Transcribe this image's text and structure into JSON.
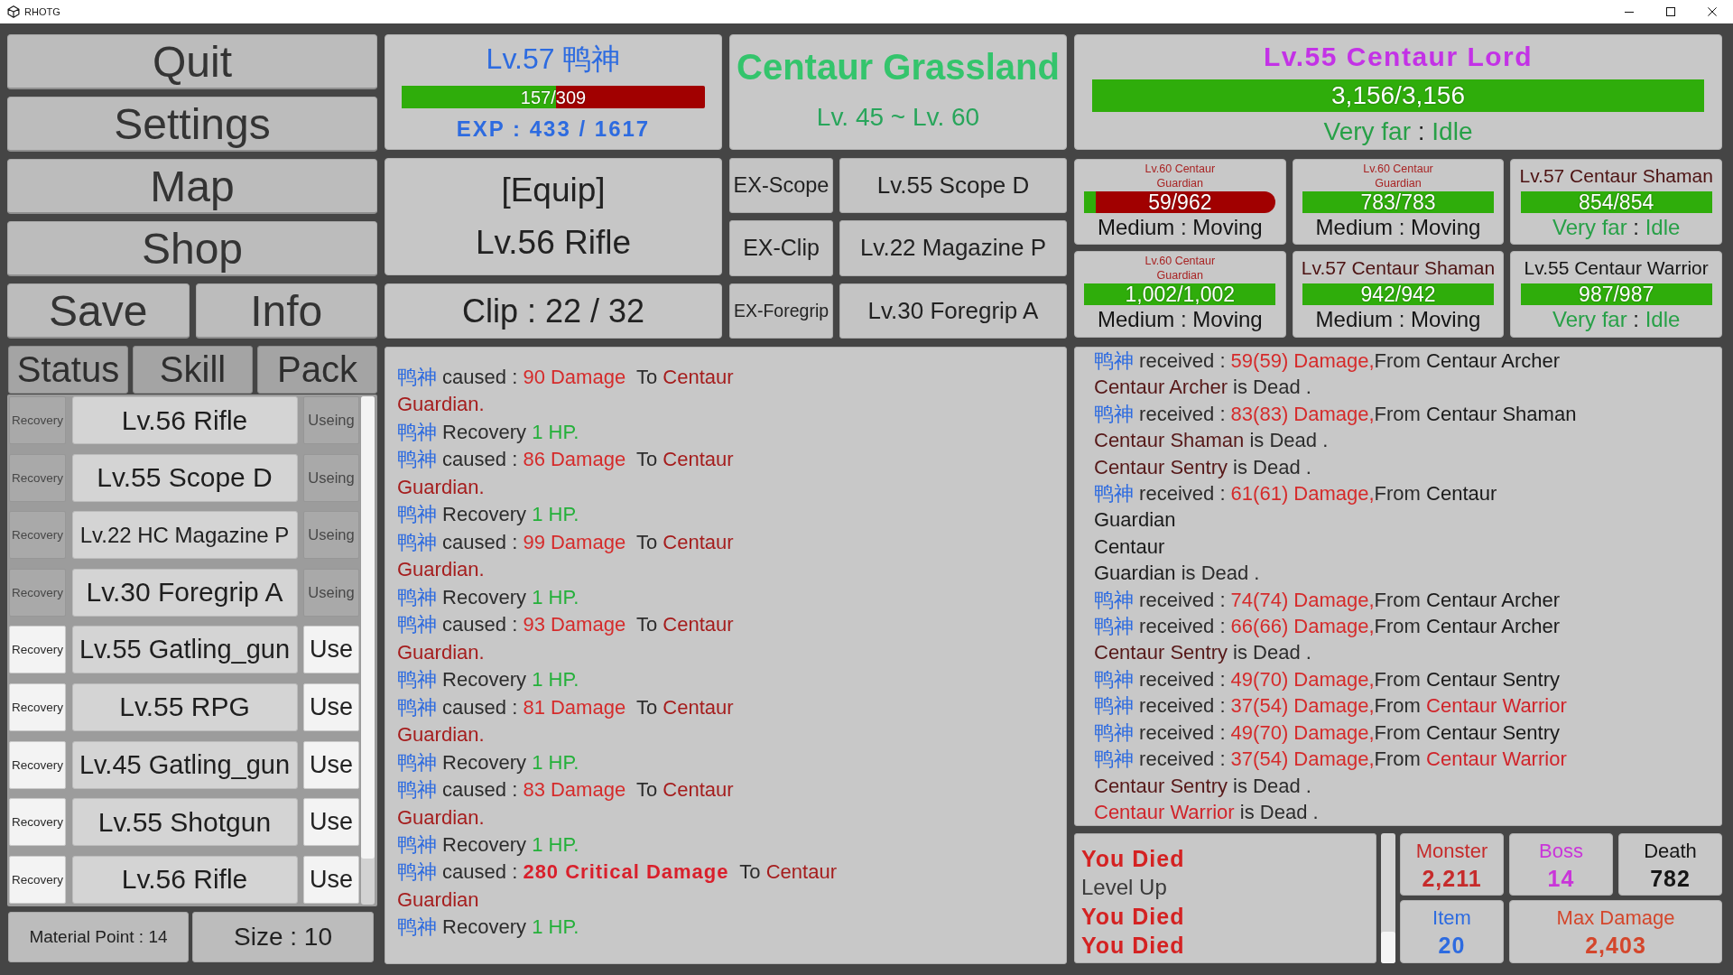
{
  "window": {
    "title": "RHOTG"
  },
  "menu_rows": [
    [
      "Quit"
    ],
    [
      "Settings"
    ],
    [
      "Map"
    ],
    [
      "Shop"
    ],
    [
      "Save",
      "Info"
    ]
  ],
  "tabs": [
    "Status",
    "Skill",
    "Pack"
  ],
  "pack": {
    "items": [
      {
        "recover": "Recovery",
        "name": "Lv.56 Rifle",
        "action": "Useing",
        "equipped": true
      },
      {
        "recover": "Recovery",
        "name": "Lv.55 Scope D",
        "action": "Useing",
        "equipped": true
      },
      {
        "recover": "Recovery",
        "name": "Lv.22 HC Magazine P",
        "action": "Useing",
        "equipped": true
      },
      {
        "recover": "Recovery",
        "name": "Lv.30 Foregrip A",
        "action": "Useing",
        "equipped": true
      },
      {
        "recover": "Recovery",
        "name": "Lv.55 Gatling_gun",
        "action": "Use",
        "equipped": false
      },
      {
        "recover": "Recovery",
        "name": "Lv.55 RPG",
        "action": "Use",
        "equipped": false
      },
      {
        "recover": "Recovery",
        "name": "Lv.45 Gatling_gun",
        "action": "Use",
        "equipped": false
      },
      {
        "recover": "Recovery",
        "name": "Lv.55 Shotgun",
        "action": "Use",
        "equipped": false
      },
      {
        "recover": "Recovery",
        "name": "Lv.56 Rifle",
        "action": "Use",
        "equipped": false
      }
    ],
    "material_point": "Material Point : 14",
    "size": "Size : 10"
  },
  "player": {
    "name": "Lv.57 鸭神",
    "hp": {
      "text": "157/309",
      "level": 0.508
    },
    "exp": "EXP : 433 / 1617"
  },
  "area": {
    "name": "Centaur Grassland",
    "levels": "Lv. 45 ~ Lv. 60"
  },
  "equip": {
    "heading": "[Equip]",
    "weapon": "Lv.56 Rifle",
    "clip": "Clip : 22 / 32",
    "slots": [
      {
        "label": "EX-Scope",
        "item": "Lv.55 Scope D"
      },
      {
        "label": "EX-Clip",
        "item": "Lv.22 Magazine P"
      },
      {
        "label": "EX-Foregrip",
        "item": "Lv.30 Foregrip A"
      }
    ]
  },
  "boss": {
    "name": "Lv.55 Centaur Lord",
    "hp": {
      "text": "3,156/3,156",
      "level": 1
    },
    "status": {
      "distance": "Very far",
      "separator": ":",
      "activity": "Idle"
    }
  },
  "monsters": [
    {
      "name": "Lv.60 Centaur\nGuardian",
      "color": "#a82424",
      "hp": {
        "text": "59/962",
        "level": 0.061
      },
      "status": {
        "distance": "Medium",
        "separator": ":",
        "activity": "Moving",
        "color": "#141414"
      }
    },
    {
      "name": "Lv.60 Centaur\nGuardian",
      "color": "#a82424",
      "hp": {
        "text": "783/783",
        "level": 1
      },
      "status": {
        "distance": "Medium",
        "separator": ":",
        "activity": "Moving",
        "color": "#141414"
      }
    },
    {
      "name": "Lv.57 Centaur Shaman",
      "color": "#4c1212",
      "hp": {
        "text": "854/854",
        "level": 1
      },
      "status": {
        "distance": "Very far",
        "separator": ":",
        "activity": "Idle",
        "color": "#27a047"
      }
    },
    {
      "name": "Lv.60 Centaur\nGuardian",
      "color": "#a82424",
      "hp": {
        "text": "1,002/1,002",
        "level": 1
      },
      "status": {
        "distance": "Medium",
        "separator": ":",
        "activity": "Moving",
        "color": "#141414"
      }
    },
    {
      "name": "Lv.57 Centaur Shaman",
      "color": "#4c1212",
      "hp": {
        "text": "942/942",
        "level": 1
      },
      "status": {
        "distance": "Medium",
        "separator": ":",
        "activity": "Moving",
        "color": "#141414"
      }
    },
    {
      "name": "Lv.55 Centaur Warrior",
      "color": "#141414",
      "hp": {
        "text": "987/987",
        "level": 1
      },
      "status": {
        "distance": "Very far",
        "separator": ":",
        "activity": "Idle",
        "color": "#27a047"
      }
    }
  ],
  "battle_log": [
    [
      {
        "text": "鸭神",
        "kind": "player"
      },
      {
        "text": " caused : ",
        "kind": "plain"
      },
      {
        "text": "90 Damage",
        "kind": "damage"
      },
      {
        "text": "  To ",
        "kind": "plain"
      },
      {
        "text": "Centaur\nGuardian.",
        "kind": "target"
      }
    ],
    [
      {
        "text": "鸭神",
        "kind": "player"
      },
      {
        "text": " Recovery ",
        "kind": "plain"
      },
      {
        "text": "1 HP.",
        "kind": "heal"
      }
    ],
    [
      {
        "text": "鸭神",
        "kind": "player"
      },
      {
        "text": " caused : ",
        "kind": "plain"
      },
      {
        "text": "86 Damage",
        "kind": "damage"
      },
      {
        "text": "  To ",
        "kind": "plain"
      },
      {
        "text": "Centaur\nGuardian.",
        "kind": "target"
      }
    ],
    [
      {
        "text": "鸭神",
        "kind": "player"
      },
      {
        "text": " Recovery ",
        "kind": "plain"
      },
      {
        "text": "1 HP.",
        "kind": "heal"
      }
    ],
    [
      {
        "text": "鸭神",
        "kind": "player"
      },
      {
        "text": " caused : ",
        "kind": "plain"
      },
      {
        "text": "99 Damage",
        "kind": "damage"
      },
      {
        "text": "  To ",
        "kind": "plain"
      },
      {
        "text": "Centaur\nGuardian.",
        "kind": "target"
      }
    ],
    [
      {
        "text": "鸭神",
        "kind": "player"
      },
      {
        "text": " Recovery ",
        "kind": "plain"
      },
      {
        "text": "1 HP.",
        "kind": "heal"
      }
    ],
    [
      {
        "text": "鸭神",
        "kind": "player"
      },
      {
        "text": " caused : ",
        "kind": "plain"
      },
      {
        "text": "93 Damage",
        "kind": "damage"
      },
      {
        "text": "  To ",
        "kind": "plain"
      },
      {
        "text": "Centaur\nGuardian.",
        "kind": "target"
      }
    ],
    [
      {
        "text": "鸭神",
        "kind": "player"
      },
      {
        "text": " Recovery ",
        "kind": "plain"
      },
      {
        "text": "1 HP.",
        "kind": "heal"
      }
    ],
    [
      {
        "text": "鸭神",
        "kind": "player"
      },
      {
        "text": " caused : ",
        "kind": "plain"
      },
      {
        "text": "81 Damage",
        "kind": "damage"
      },
      {
        "text": "  To ",
        "kind": "plain"
      },
      {
        "text": "Centaur\nGuardian.",
        "kind": "target"
      }
    ],
    [
      {
        "text": "鸭神",
        "kind": "player"
      },
      {
        "text": " Recovery ",
        "kind": "plain"
      },
      {
        "text": "1 HP.",
        "kind": "heal"
      }
    ],
    [
      {
        "text": "鸭神",
        "kind": "player"
      },
      {
        "text": " caused : ",
        "kind": "plain"
      },
      {
        "text": "83 Damage",
        "kind": "damage"
      },
      {
        "text": "  To ",
        "kind": "plain"
      },
      {
        "text": "Centaur\nGuardian.",
        "kind": "target"
      }
    ],
    [
      {
        "text": "鸭神",
        "kind": "player"
      },
      {
        "text": " Recovery ",
        "kind": "plain"
      },
      {
        "text": "1 HP.",
        "kind": "heal"
      }
    ],
    [
      {
        "text": "鸭神",
        "kind": "player"
      },
      {
        "text": " caused : ",
        "kind": "plain"
      },
      {
        "text": "280 Critical Damage",
        "kind": "critical"
      },
      {
        "text": "  To ",
        "kind": "plain"
      },
      {
        "text": "Centaur\nGuardian",
        "kind": "target"
      }
    ],
    [
      {
        "text": "鸭神",
        "kind": "player"
      },
      {
        "text": " Recovery ",
        "kind": "plain"
      },
      {
        "text": "1 HP.",
        "kind": "heal"
      }
    ]
  ],
  "event_log": [
    [
      {
        "text": "鸭神",
        "kind": "player"
      },
      {
        "text": " received : ",
        "kind": "plain"
      },
      {
        "text": "59(59) Damage,",
        "kind": "damage"
      },
      {
        "text": "From ",
        "kind": "plain"
      },
      {
        "text": "Centaur Archer",
        "kind": "foe"
      }
    ],
    [
      {
        "text": "Centaur Archer",
        "kind": "fallen"
      },
      {
        "text": " is Dead .",
        "kind": "plain"
      }
    ],
    [
      {
        "text": "鸭神",
        "kind": "player"
      },
      {
        "text": " received : ",
        "kind": "plain"
      },
      {
        "text": "83(83) Damage,",
        "kind": "damage"
      },
      {
        "text": "From ",
        "kind": "plain"
      },
      {
        "text": "Centaur Shaman",
        "kind": "foe"
      }
    ],
    [
      {
        "text": "Centaur Shaman",
        "kind": "fallen"
      },
      {
        "text": " is Dead .",
        "kind": "plain"
      }
    ],
    [
      {
        "text": "Centaur Sentry",
        "kind": "fallen"
      },
      {
        "text": " is Dead .",
        "kind": "plain"
      }
    ],
    [
      {
        "text": "鸭神",
        "kind": "player"
      },
      {
        "text": " received : ",
        "kind": "plain"
      },
      {
        "text": "61(61) Damage,",
        "kind": "damage"
      },
      {
        "text": "From ",
        "kind": "plain"
      },
      {
        "text": "Centaur\nGuardian",
        "kind": "foe"
      }
    ],
    [
      {
        "text": "Centaur\nGuardian",
        "kind": "foe"
      },
      {
        "text": " is Dead .",
        "kind": "plain"
      }
    ],
    [
      {
        "text": "鸭神",
        "kind": "player"
      },
      {
        "text": " received : ",
        "kind": "plain"
      },
      {
        "text": "74(74) Damage,",
        "kind": "damage"
      },
      {
        "text": "From ",
        "kind": "plain"
      },
      {
        "text": "Centaur Archer",
        "kind": "foe"
      }
    ],
    [
      {
        "text": "鸭神",
        "kind": "player"
      },
      {
        "text": " received : ",
        "kind": "plain"
      },
      {
        "text": "66(66) Damage,",
        "kind": "damage"
      },
      {
        "text": "From ",
        "kind": "plain"
      },
      {
        "text": "Centaur Archer",
        "kind": "foe"
      }
    ],
    [
      {
        "text": "Centaur Sentry",
        "kind": "fallen"
      },
      {
        "text": " is Dead .",
        "kind": "plain"
      }
    ],
    [
      {
        "text": "鸭神",
        "kind": "player"
      },
      {
        "text": " received : ",
        "kind": "plain"
      },
      {
        "text": "49(70) Damage,",
        "kind": "damage"
      },
      {
        "text": "From ",
        "kind": "plain"
      },
      {
        "text": "Centaur Sentry",
        "kind": "foe"
      }
    ],
    [
      {
        "text": "鸭神",
        "kind": "player"
      },
      {
        "text": " received : ",
        "kind": "plain"
      },
      {
        "text": "37(54) Damage,",
        "kind": "damage"
      },
      {
        "text": "From ",
        "kind": "plain"
      },
      {
        "text": "Centaur Warrior",
        "kind": "threat"
      }
    ],
    [
      {
        "text": "鸭神",
        "kind": "player"
      },
      {
        "text": " received : ",
        "kind": "plain"
      },
      {
        "text": "49(70) Damage,",
        "kind": "damage"
      },
      {
        "text": "From ",
        "kind": "plain"
      },
      {
        "text": "Centaur Sentry",
        "kind": "foe"
      }
    ],
    [
      {
        "text": "鸭神",
        "kind": "player"
      },
      {
        "text": " received : ",
        "kind": "plain"
      },
      {
        "text": "37(54) Damage,",
        "kind": "damage"
      },
      {
        "text": "From ",
        "kind": "plain"
      },
      {
        "text": "Centaur Warrior",
        "kind": "threat"
      }
    ],
    [
      {
        "text": "Centaur Sentry",
        "kind": "fallen"
      },
      {
        "text": " is Dead .",
        "kind": "plain"
      }
    ],
    [
      {
        "text": "Centaur Warrior",
        "kind": "threat"
      },
      {
        "text": " is Dead .",
        "kind": "plain"
      }
    ]
  ],
  "messages": [
    {
      "text": "You Died",
      "kind": "alert"
    },
    {
      "text": "Level Up",
      "kind": "info"
    },
    {
      "text": "You Died",
      "kind": "alert"
    },
    {
      "text": "You Died",
      "kind": "alert"
    }
  ],
  "stats": [
    {
      "label": "Monster",
      "value": "2,211",
      "color": "#c62b2b"
    },
    {
      "label": "Boss",
      "value": "14",
      "color": "#c935d9"
    },
    {
      "label": "Death",
      "value": "782",
      "color": "#161616"
    },
    {
      "label": "Item",
      "value": "20",
      "color": "#2d6be0"
    },
    {
      "label": "Max Damage",
      "value": "2,403",
      "color": "#d4462b"
    }
  ]
}
